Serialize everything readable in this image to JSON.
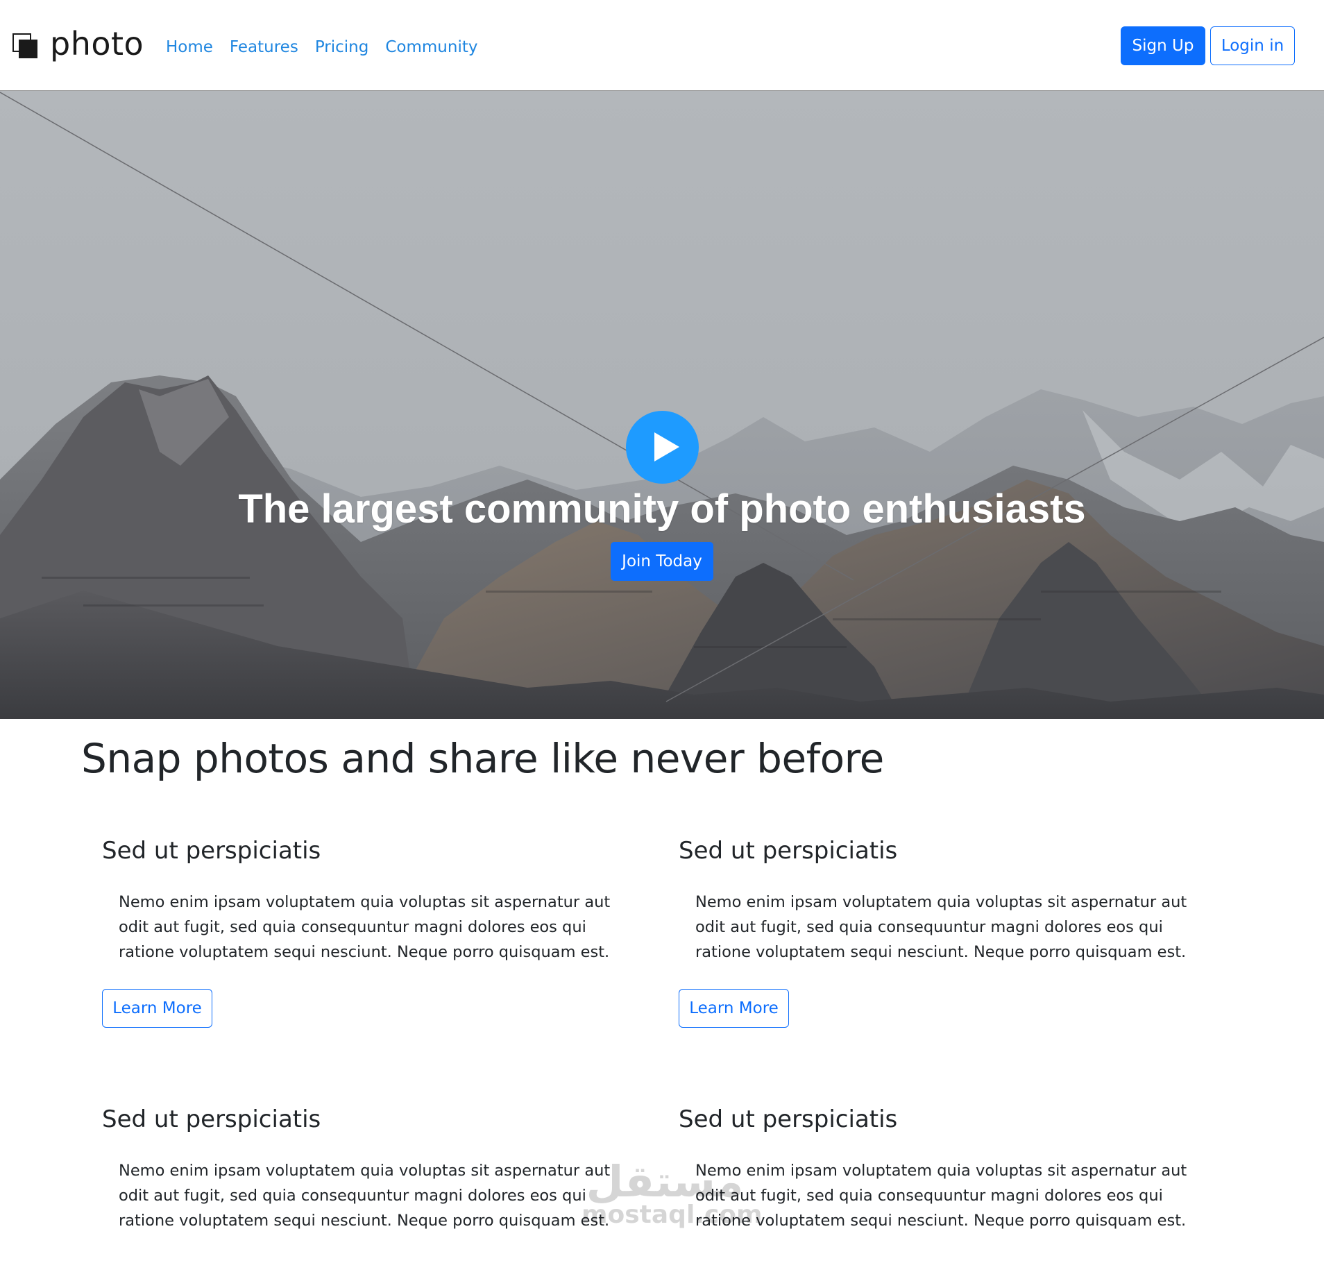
{
  "navbar": {
    "brand": "photo",
    "links": [
      {
        "label": "Home"
      },
      {
        "label": "Features"
      },
      {
        "label": "Pricing"
      },
      {
        "label": "Community"
      }
    ],
    "signup_label": "Sign Up",
    "login_label": "Login in"
  },
  "hero": {
    "title": "The largest community of photo enthusiasts",
    "join_label": "Join Today",
    "play_icon": "play-icon"
  },
  "main": {
    "section_title": "Snap photos and share like never before",
    "features": [
      {
        "title": "Sed ut perspiciatis",
        "text": "Nemo enim ipsam voluptatem quia voluptas sit aspernatur aut odit aut fugit, sed quia consequuntur magni dolores eos qui ratione voluptatem sequi nesciunt. Neque porro quisquam est.",
        "button": "Learn More"
      },
      {
        "title": "Sed ut perspiciatis",
        "text": "Nemo enim ipsam voluptatem quia voluptas sit aspernatur aut odit aut fugit, sed quia consequuntur magni dolores eos qui ratione voluptatem sequi nesciunt. Neque porro quisquam est.",
        "button": "Learn More"
      },
      {
        "title": "Sed ut perspiciatis",
        "text": "Nemo enim ipsam voluptatem quia voluptas sit aspernatur aut odit aut fugit, sed quia consequuntur magni dolores eos qui ratione voluptatem sequi nesciunt. Neque porro quisquam est."
      },
      {
        "title": "Sed ut perspiciatis",
        "text": "Nemo enim ipsam voluptatem quia voluptas sit aspernatur aut odit aut fugit, sed quia consequuntur magni dolores eos qui ratione voluptatem sequi nesciunt. Neque porro quisquam est."
      }
    ]
  },
  "watermark": {
    "arabic": "مستقل",
    "latin": "mostaql.com"
  },
  "colors": {
    "primary": "#0d6efd",
    "link": "#1f86e0",
    "play": "#1e9bff",
    "text": "#212529"
  }
}
